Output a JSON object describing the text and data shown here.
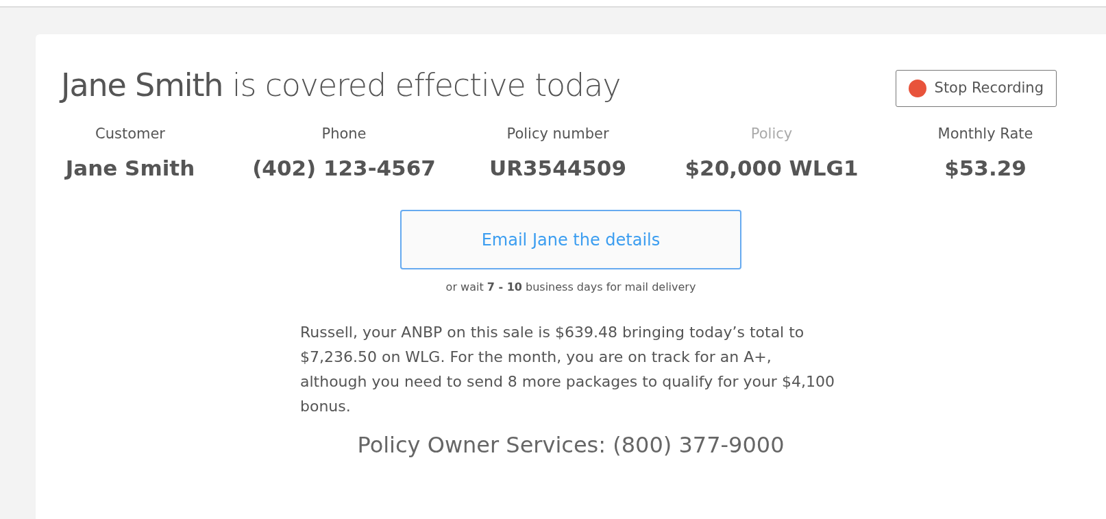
{
  "heading": "**Jane Smith** is covered effective today",
  "record_button": {
    "label": "Stop Recording",
    "recording": true
  },
  "stats": [
    {
      "label": "Customer",
      "value": "Jane Smith",
      "dimmed": false
    },
    {
      "label": "Phone",
      "value": "(402) 123-4567",
      "dimmed": false
    },
    {
      "label": "Policy number",
      "value": "UR3544509",
      "dimmed": false
    },
    {
      "label": "Policy",
      "value": "$20,000 WLG1",
      "dimmed": true
    },
    {
      "label": "Monthly Rate",
      "value": "$53.29",
      "dimmed": false
    }
  ],
  "email_button": "Email Jane the details",
  "mail_note": "or wait **7 - 10** business days for mail delivery",
  "message": "Russell, your ANBP on this sale is $639.48 bringing today’s total to $7,236.50 on WLG. For the month, you are on track for an A+, although you need to send 8 more packages to qualify for your $4,100 bonus.",
  "services": "Policy Owner Services: (800) 377-9000"
}
